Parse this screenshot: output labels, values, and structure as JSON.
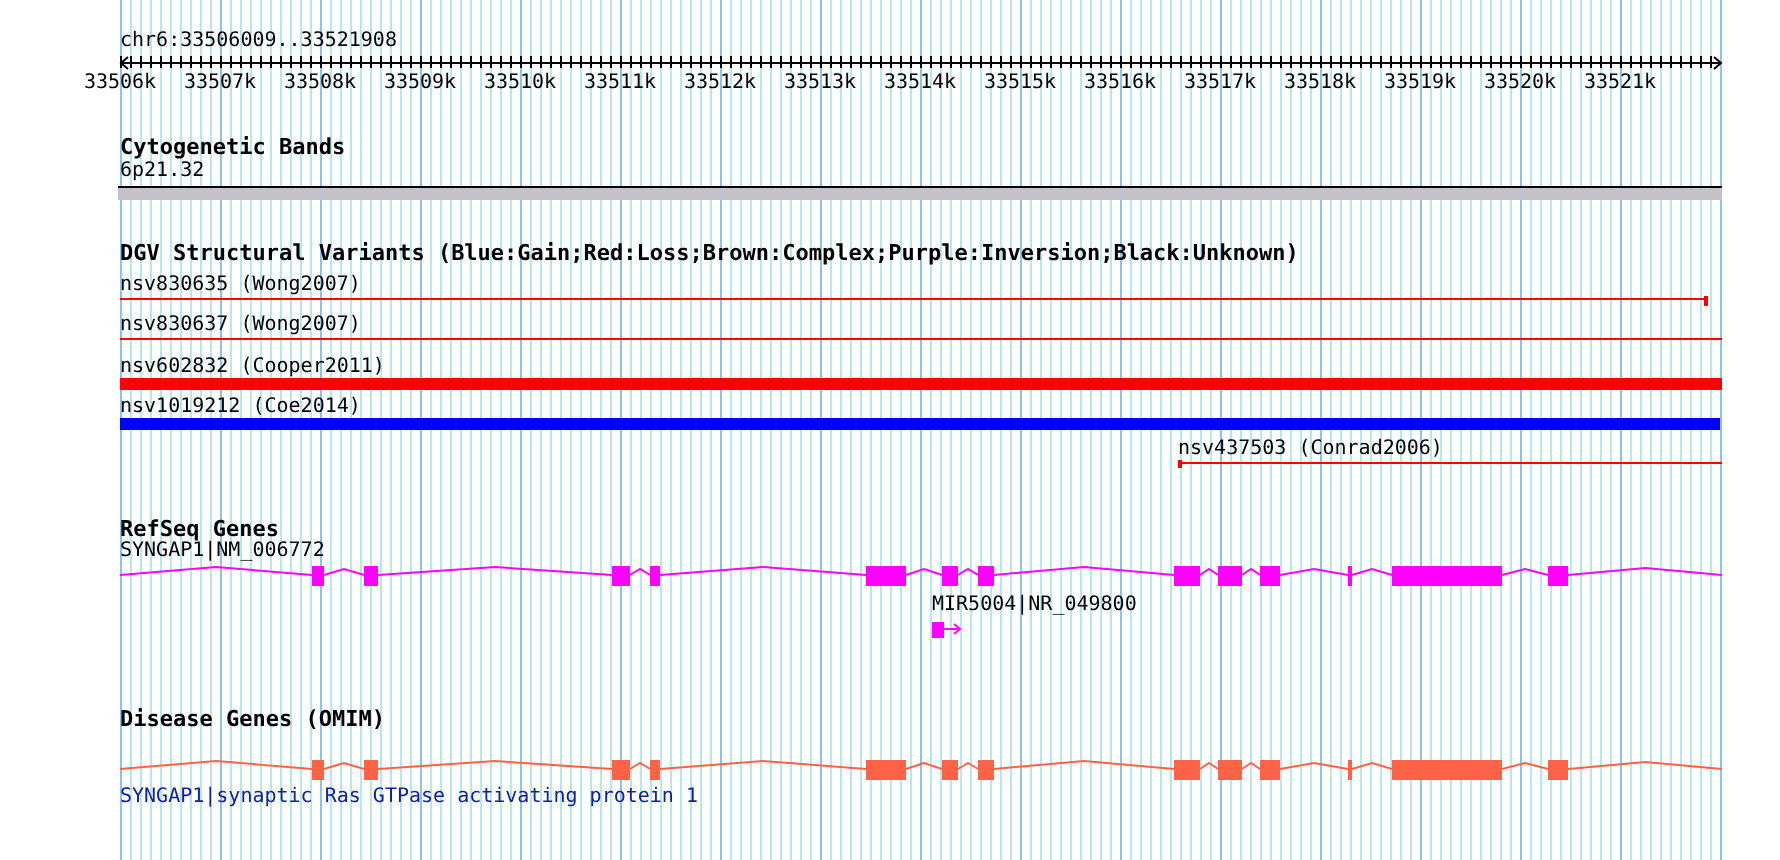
{
  "ruler": {
    "location": "chr6:33506009..33521908",
    "ticks": [
      "33506k",
      "33507k",
      "33508k",
      "33509k",
      "33510k",
      "33511k",
      "33512k",
      "33513k",
      "33514k",
      "33515k",
      "33516k",
      "33517k",
      "33518k",
      "33519k",
      "33520k",
      "33521k"
    ]
  },
  "tracks": [
    {
      "kind": "cytoband",
      "title": "Cytogenetic Bands",
      "features": [
        {
          "label": "6p21.32"
        }
      ]
    },
    {
      "kind": "variants",
      "title": "DGV Structural Variants (Blue:Gain;Red:Loss;Brown:Complex;Purple:Inversion;Black:Unknown)",
      "features": [
        {
          "label": "nsv830635 (Wong2007)",
          "color": "#ff0000"
        },
        {
          "label": "nsv830637 (Wong2007)",
          "color": "#ff0000"
        },
        {
          "label": "nsv602832 (Cooper2011)",
          "color": "#ff0000"
        },
        {
          "label": "nsv1019212 (Coe2014)",
          "color": "#0000ff"
        },
        {
          "label": "nsv437503 (Conrad2006)",
          "color": "#ff0000"
        }
      ]
    },
    {
      "kind": "genes",
      "title": "RefSeq Genes",
      "features": [
        {
          "label": "SYNGAP1|NM_006772",
          "color": "#ff00ff"
        },
        {
          "label": "MIR5004|NR_049800",
          "color": "#ff00ff"
        }
      ]
    },
    {
      "kind": "omim",
      "title": "Disease Genes (OMIM)",
      "features": [
        {
          "label": "SYNGAP1|synaptic Ras GTPase activating protein 1",
          "color": "#ff6347"
        }
      ]
    }
  ]
}
